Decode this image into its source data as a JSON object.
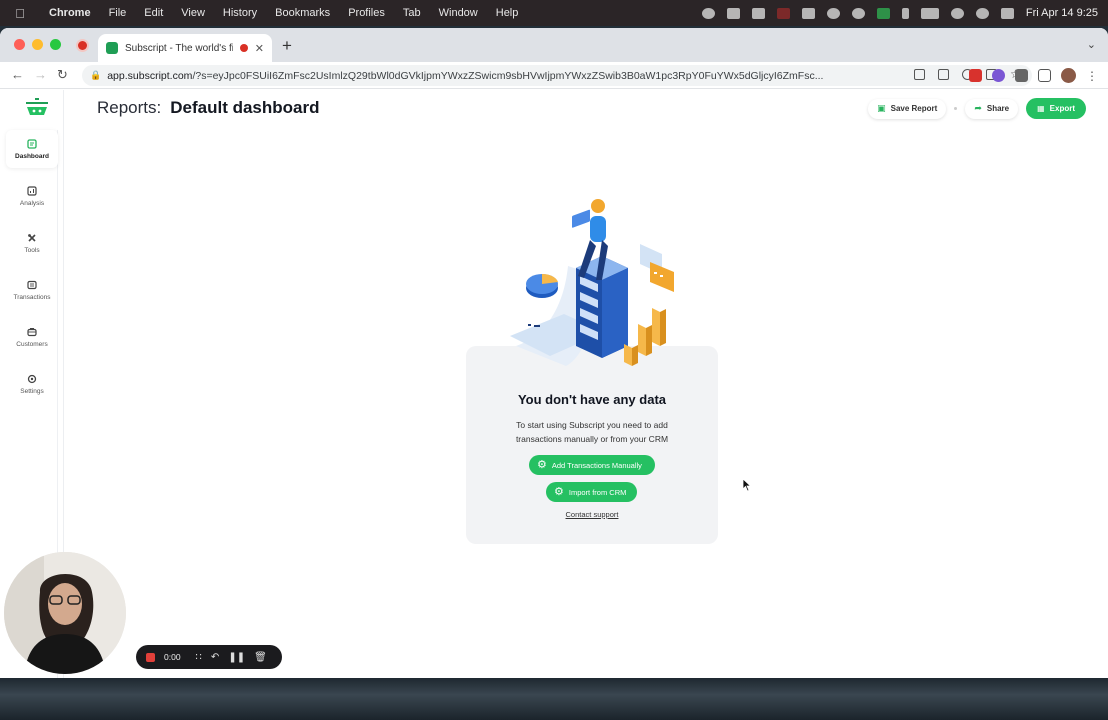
{
  "menubar": {
    "app_name": "Chrome",
    "items": [
      "File",
      "Edit",
      "View",
      "History",
      "Bookmarks",
      "Profiles",
      "Tab",
      "Window",
      "Help"
    ],
    "clock": "Fri Apr 14  9:25"
  },
  "browser": {
    "tab_title": "Subscript - The world's fir",
    "url_host": "app.subscript.com",
    "url_rest": "/?s=eyJpc0FSUiI6ZmFsc2UsImlzQ29tbWl0dGVkIjpmYWxzZSwicm9sbHVwIjpmYWxzZSwib3B0aW1pc3RpY0FuYWx5dGljcyI6ZmFsc..."
  },
  "header": {
    "crumb": "Reports:",
    "title": "Default dashboard",
    "save_label": "Save Report",
    "share_label": "Share",
    "export_label": "Export"
  },
  "sidebar": {
    "items": [
      {
        "label": "Dashboard",
        "icon": "dashboard-icon",
        "active": true
      },
      {
        "label": "Analysis",
        "icon": "analysis-icon",
        "active": false
      },
      {
        "label": "Tools",
        "icon": "tools-icon",
        "active": false
      },
      {
        "label": "Transactions",
        "icon": "transactions-icon",
        "active": false
      },
      {
        "label": "Customers",
        "icon": "customers-icon",
        "active": false
      },
      {
        "label": "Settings",
        "icon": "settings-icon",
        "active": false
      }
    ]
  },
  "empty_state": {
    "title": "You don't have any data",
    "line1": "To start using Subscript you need to add",
    "line2": "transactions manually or from your CRM",
    "add_manual_label": "Add Transactions Manually",
    "import_crm_label": "Import from CRM",
    "contact_label": "Contact support"
  },
  "recorder": {
    "time": "0:00"
  },
  "colors": {
    "accent_green": "#25c062",
    "recording_red": "#e2403a"
  }
}
